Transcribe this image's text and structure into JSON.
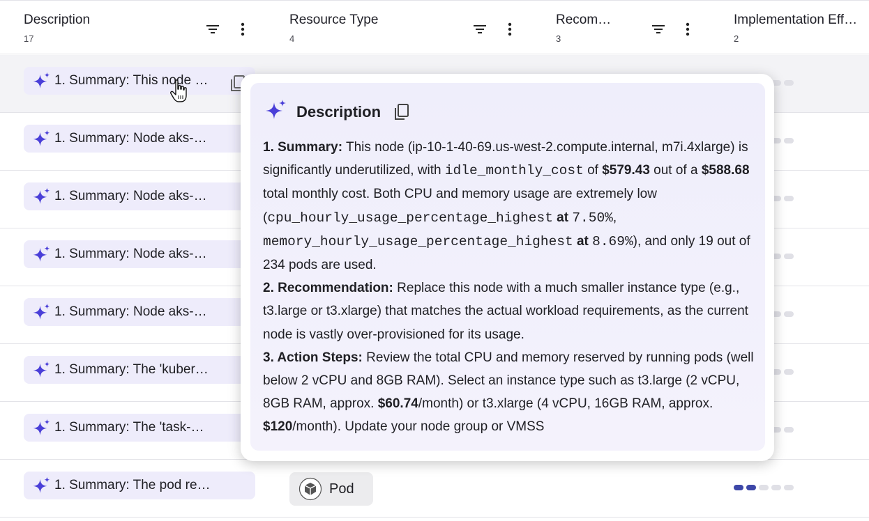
{
  "columns": [
    {
      "title": "Description",
      "count": "17"
    },
    {
      "title": "Resource Type",
      "count": "4"
    },
    {
      "title": "Recom…",
      "count": "3"
    },
    {
      "title": "Implementation Eff…",
      "count": "2"
    }
  ],
  "rows": [
    {
      "summary": "1. Summary: This node …",
      "effort_level": 2
    },
    {
      "summary": "1. Summary: Node aks-…",
      "effort_level": 2
    },
    {
      "summary": "1. Summary: Node aks-…",
      "effort_level": 2
    },
    {
      "summary": "1. Summary: Node aks-…",
      "effort_level": 2
    },
    {
      "summary": "1. Summary: Node aks-…",
      "effort_level": 2
    },
    {
      "summary": "1. Summary: The 'kuber…",
      "effort_level": 2
    },
    {
      "summary": "1. Summary: The 'task-…",
      "effort_level": 2
    },
    {
      "summary": "1. Summary: The pod re…",
      "resource_type": "Pod",
      "effort_level": 2
    }
  ],
  "effort_max": 5,
  "popup": {
    "title": "Description",
    "summary_label": "1. Summary:",
    "summary_t1": " This node (ip-10-1-40-69.us-west-2.compute.internal, m7i.4xlarge) is significantly underutilized, with ",
    "summary_code1": "idle_monthly_cost",
    "summary_t2": " of ",
    "summary_b1": "$579.43",
    "summary_t3": " out of a ",
    "summary_b2": "$588.68",
    "summary_t4": " total monthly cost. Both CPU and memory usage are extremely low (",
    "summary_code2": "cpu_hourly_usage_percentage_highest",
    "summary_t5": " at ",
    "summary_code3": "7.50%",
    "summary_t6": ", ",
    "summary_code4": "memory_hourly_usage_percentage_highest",
    "summary_t7": " at ",
    "summary_code5": "8.69%",
    "summary_t8": "), and only 19 out of 234 pods are used.",
    "rec_label": "2. Recommendation:",
    "rec_text": " Replace this node with a much smaller instance type (e.g., t3.large or t3.xlarge) that matches the actual workload requirements, as the current node is vastly over-provisioned for its usage.",
    "act_label": "3. Action Steps:",
    "act_t1": " Review the total CPU and memory reserved by running pods (well below 2 vCPU and 8GB RAM). Select an instance type such as t3.large (2 vCPU, 8GB RAM, approx. ",
    "act_b1": "$60.74",
    "act_t2": "/month) or t3.xlarge (4 vCPU, 16GB RAM, approx. ",
    "act_b2": "$120",
    "act_t3": "/month). Update your node group or VMSS"
  },
  "colors": {
    "accent": "#3d47a8",
    "chip_bg": "#eeecfb",
    "spark": "#4a3fd8"
  }
}
